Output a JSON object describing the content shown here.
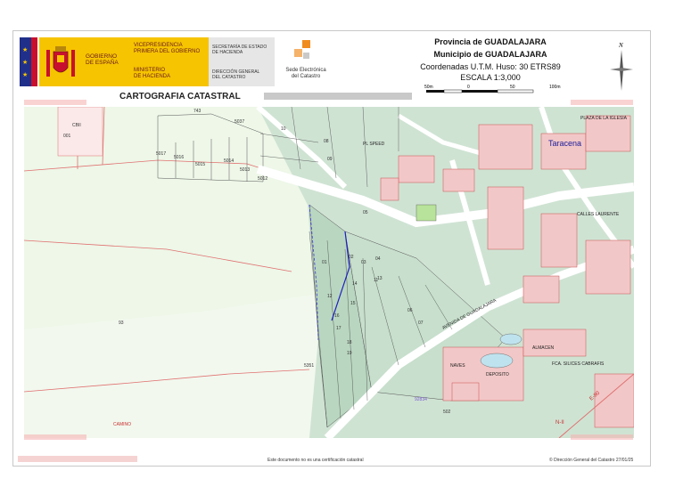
{
  "header": {
    "gobierno_line1": "GOBIERNO",
    "gobierno_line2": "DE ESPAÑA",
    "vicepresidencia_line1": "VICEPRESIDENCIA",
    "vicepresidencia_line2": "PRIMERA DEL GOBIERNO",
    "ministerio_line1": "MINISTERIO",
    "ministerio_line2": "DE HACIENDA",
    "secretaria_line1": "SECRETARÍA DE ESTADO",
    "secretaria_line2": "DE HACIENDA",
    "direccion_line1": "DIRECCIÓN GENERAL",
    "direccion_line2": "DEL CATASTRO",
    "sede_line1": "Sede Electrónica",
    "sede_line2": "del Catastro",
    "provincia": "Provincia de GUADALAJARA",
    "municipio": "Municipio de GUADALAJARA",
    "coordenadas": "Coordenadas U.T.M. Huso: 30 ETRS89",
    "escala": "ESCALA 1:3,000",
    "scale_labels": [
      "50m",
      "0",
      "50",
      "100m"
    ],
    "title": "CARTOGRAFIA CATASTRAL",
    "north": "N"
  },
  "map": {
    "place_labels": [
      "Taracena",
      "PLAZA DE LA IGLESIA",
      "PL SPEED",
      "CALLES LAURENTE",
      "AVENIDA DE GUADALAJARA",
      "FCA. SILICES CABRAFIS",
      "NAVES",
      "DEPOSITO",
      "ALMACEN",
      "E-90",
      "N-II",
      "CAMINO"
    ],
    "parcel_labels": [
      "CBII",
      "001",
      "743",
      "5017",
      "5016",
      "5015",
      "5014",
      "5013",
      "5012",
      "5037",
      "93",
      "01",
      "02",
      "03",
      "04",
      "05",
      "06",
      "07",
      "08",
      "09",
      "10",
      "11",
      "12",
      "13",
      "14",
      "15",
      "16",
      "17",
      "18",
      "19",
      "5351",
      "92834",
      "502"
    ]
  },
  "footer": {
    "disclaimer": "Este documento no es una certificación catastral",
    "copyright": "© Dirección General del Catastro 27/01/25"
  }
}
